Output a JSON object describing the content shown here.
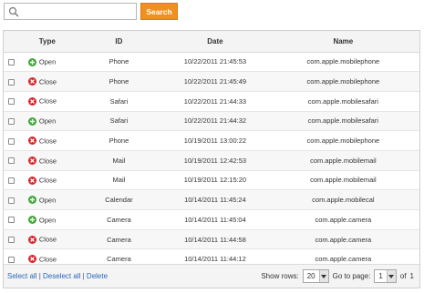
{
  "search": {
    "placeholder": "",
    "value": "",
    "button_label": "Search"
  },
  "table": {
    "headers": {
      "type": "Type",
      "id": "ID",
      "date": "Date",
      "name": "Name"
    },
    "rows": [
      {
        "type": "Open",
        "id": "Phone",
        "date": "10/22/2011 21:45:53",
        "name": "com.apple.mobilephone"
      },
      {
        "type": "Close",
        "id": "Phone",
        "date": "10/22/2011 21:45:49",
        "name": "com.apple.mobilephone"
      },
      {
        "type": "Close",
        "id": "Safari",
        "date": "10/22/2011 21:44:33",
        "name": "com.apple.mobilesafari"
      },
      {
        "type": "Open",
        "id": "Safari",
        "date": "10/22/2011 21:44:32",
        "name": "com.apple.mobilesafari"
      },
      {
        "type": "Close",
        "id": "Phone",
        "date": "10/19/2011 13:00:22",
        "name": "com.apple.mobilephone"
      },
      {
        "type": "Close",
        "id": "Mail",
        "date": "10/19/2011 12:42:53",
        "name": "com.apple.mobilemail"
      },
      {
        "type": "Close",
        "id": "Mail",
        "date": "10/19/2011 12:15:20",
        "name": "com.apple.mobilemail"
      },
      {
        "type": "Open",
        "id": "Calendar",
        "date": "10/14/2011 11:45:24",
        "name": "com.apple.mobilecal"
      },
      {
        "type": "Open",
        "id": "Camera",
        "date": "10/14/2011 11:45:04",
        "name": "com.apple.camera"
      },
      {
        "type": "Close",
        "id": "Camera",
        "date": "10/14/2011 11:44:58",
        "name": "com.apple.camera"
      },
      {
        "type": "Close",
        "id": "Camera",
        "date": "10/14/2011 11:44:12",
        "name": "com.apple.camera"
      }
    ]
  },
  "footer": {
    "select_all": "Select all",
    "deselect_all": "Deselect all",
    "delete": "Delete",
    "separator": "|",
    "show_rows_label": "Show rows:",
    "show_rows_value": "20",
    "goto_label": "Go to page:",
    "page_value": "1",
    "of_label": "of",
    "total_pages": "1"
  },
  "colors": {
    "accent": "#f0901f",
    "open": "#3da935",
    "close": "#d8232a",
    "link": "#2a67b8"
  },
  "icons": {
    "search": "search-icon",
    "open": "plus-circle-icon",
    "close": "x-circle-icon",
    "dropdown": "chevron-down-icon"
  }
}
